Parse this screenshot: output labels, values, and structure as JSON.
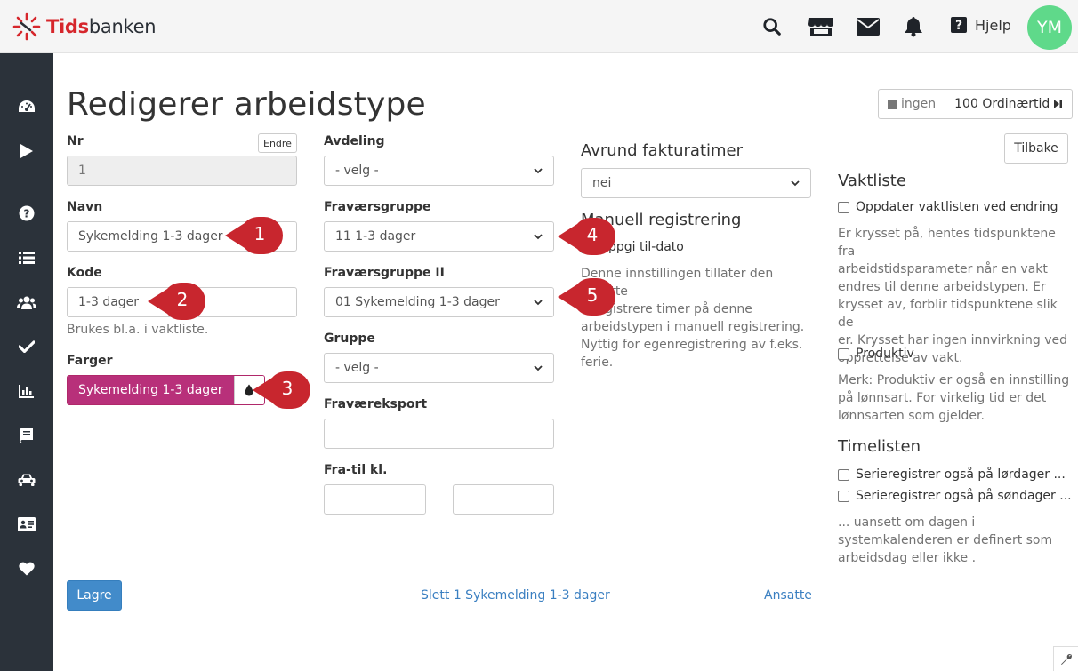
{
  "app": {
    "logo_text_accent": "Tids",
    "logo_text_rest": "banken",
    "help_label": "Hjelp",
    "avatar_initials": "YM"
  },
  "colors": {
    "sidebar_bg": "#2b323a",
    "primary": "#428bca",
    "callout_red": "#c8262e",
    "color_tag": "#b8307a",
    "avatar_bg": "#5fd98a"
  },
  "page": {
    "title": "Redigerer arbeidstype",
    "status_ingen": "ingen",
    "status_type": "100 Ordinærtid",
    "back_label": "Tilbake"
  },
  "form": {
    "nr": {
      "label": "Nr",
      "value": "1",
      "edit_label": "Endre"
    },
    "navn": {
      "label": "Navn",
      "value": "Sykemelding 1-3 dager"
    },
    "kode": {
      "label": "Kode",
      "value": "1-3 dager",
      "help": "Brukes bl.a. i vaktliste."
    },
    "farger": {
      "label": "Farger",
      "value": "Sykemelding 1-3 dager"
    },
    "avdeling": {
      "label": "Avdeling",
      "value": "- velg -"
    },
    "fravaersgruppe": {
      "label": "Fraværsgruppe",
      "value": "11 1-3 dager"
    },
    "fravaersgruppe2": {
      "label": "Fraværsgruppe II",
      "value": "01 Sykemelding 1-3 dager"
    },
    "gruppe": {
      "label": "Gruppe",
      "value": "- velg -"
    },
    "fravaerseksport": {
      "label": "Fraværeksport",
      "value": ""
    },
    "fratil": {
      "label": "Fra-til kl.",
      "from": "",
      "to": ""
    }
  },
  "fakturatimer": {
    "heading": "Avrund fakturatimer",
    "value": "nei"
  },
  "manuell": {
    "heading": "Manuell registrering",
    "checkbox_label": "Oppgi til-dato",
    "description_lines": [
      "Denne innstillingen tillater den ansatte",
      "å registrere timer på denne",
      "arbeidstypen i manuell registrering.",
      "Nyttig for egenregistrering av f.eks.",
      "ferie."
    ]
  },
  "vaktliste": {
    "heading": "Vaktliste",
    "checkbox_label": "Oppdater vaktlisten ved endring",
    "description_lines": [
      "Er krysset på, hentes tidspunktene fra",
      "arbeidstidsparameter når en vakt",
      "endres til denne arbeidstypen. Er",
      "krysset av, forblir tidspunktene slik de",
      "er. Krysset har ingen innvirkning ved",
      "opprettelse av vakt."
    ],
    "produktiv_label": "Produktiv",
    "produktiv_lines": [
      "Merk: Produktiv er også en innstilling",
      "på lønnsart. For virkelig tid er det",
      "lønnsarten som gjelder."
    ]
  },
  "timelisten": {
    "heading": "Timelisten",
    "lordag_label": "Serieregistrer også på lørdager ...",
    "sondag_label": "Serieregistrer også på søndager ...",
    "description_lines": [
      "... uansett om dagen i",
      "systemkalenderen er definert som",
      "arbeidsdag eller ikke ."
    ]
  },
  "actions": {
    "save_label": "Lagre",
    "delete_label": "Slett 1 Sykemelding 1-3 dager",
    "employees_label": "Ansatte"
  },
  "callouts": [
    "1",
    "2",
    "3",
    "4",
    "5"
  ]
}
